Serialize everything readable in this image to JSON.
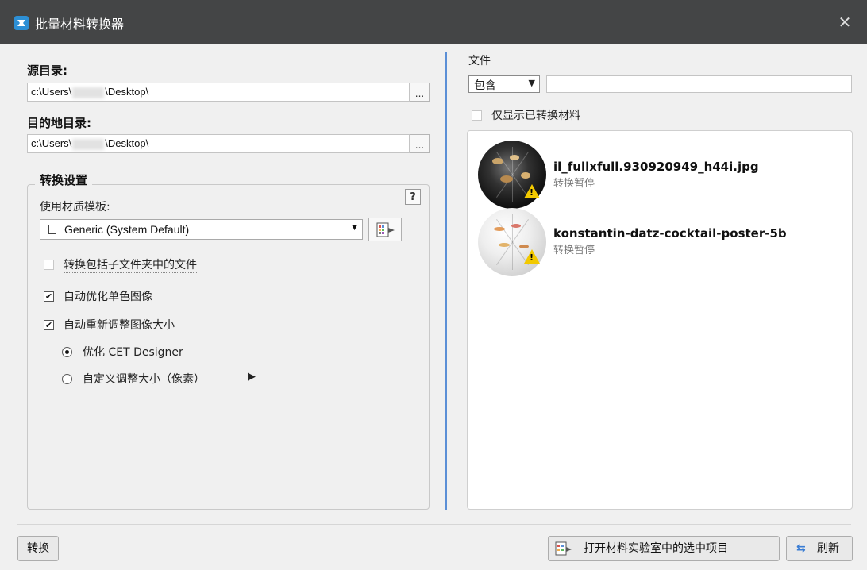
{
  "window": {
    "title": "批量材料转换器",
    "close_glyph": "✕",
    "accent_color": "#5b8fd6",
    "titlebar_color": "#444546"
  },
  "source": {
    "label": "源目录:",
    "path_prefix": "c:\\Users\\",
    "path_suffix": "\\Desktop\\",
    "browse_label": "..."
  },
  "destination": {
    "label": "目的地目录:",
    "path_prefix": "c:\\Users\\",
    "path_suffix": "\\Desktop\\",
    "browse_label": "..."
  },
  "settings": {
    "group_title": "转换设置",
    "help_label": "?",
    "template_label": "使用材质模板:",
    "template_value": "Generic (System Default)",
    "include_subfolders": {
      "label": "转换包括子文件夹中的文件",
      "checked": false
    },
    "auto_optimize_mono": {
      "label": "自动优化单色图像",
      "checked": true
    },
    "auto_resize": {
      "label": "自动重新调整图像大小",
      "checked": true
    },
    "radio_optimize": {
      "label": "优化 CET Designer",
      "selected": true
    },
    "radio_custom": {
      "label": "自定义调整大小（像素）",
      "selected": false,
      "arrow": "▶"
    }
  },
  "files": {
    "label": "文件",
    "filter_option": "包含",
    "filter_value": "",
    "only_converted": {
      "label": "仅显示已转换材料",
      "checked": false
    },
    "items": [
      {
        "name": "il_fullxfull.930920949_h44i.jpg",
        "status": "转换暂停",
        "icon": "warning-icon"
      },
      {
        "name": "konstantin-datz-cocktail-poster-5b",
        "status": "转换暂停",
        "icon": "warning-icon"
      }
    ]
  },
  "footer": {
    "convert_label": "转换",
    "open_in_lab_label": "打开材料实验室中的选中项目",
    "refresh_label": "刷新"
  }
}
